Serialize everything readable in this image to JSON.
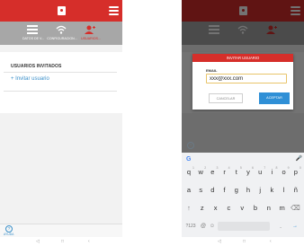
{
  "app": {
    "toolbar": [
      {
        "label": "DATOS DE V..."
      },
      {
        "label": "CONFIGURACION..."
      },
      {
        "label": "USUARIOS..."
      }
    ],
    "section_title": "USUARIOS INVITADOS",
    "invite_link": "+ Invitar usuario",
    "help_label": "AYUDA"
  },
  "dialog": {
    "title": "INVITAR USUARIO",
    "email_label": "EMAIL",
    "email_value": "xxx@xxx.com",
    "cancel": "CANCELAR",
    "accept": "ACEPTAR"
  },
  "keyboard": {
    "row1": [
      "q",
      "w",
      "e",
      "r",
      "t",
      "y",
      "u",
      "i",
      "o",
      "p"
    ],
    "row1_hints": [
      "1",
      "2",
      "3",
      "4",
      "5",
      "6",
      "7",
      "8",
      "9",
      "0"
    ],
    "row2": [
      "a",
      "s",
      "d",
      "f",
      "g",
      "h",
      "j",
      "k",
      "l",
      "ñ"
    ],
    "row3": [
      "↑",
      "z",
      "x",
      "c",
      "v",
      "b",
      "n",
      "m",
      "⌫"
    ],
    "row4_left": "?123",
    "row4_comma": "@",
    "row4_emoji": "☺",
    "row4_period": ".",
    "row4_enter": "→"
  },
  "nav": {
    "back": "◁",
    "home": "□",
    "recent": "‹"
  },
  "colors": {
    "brand_red": "#d62e2a",
    "link_blue": "#3a8fc9",
    "accept_blue": "#2f8fd6"
  }
}
